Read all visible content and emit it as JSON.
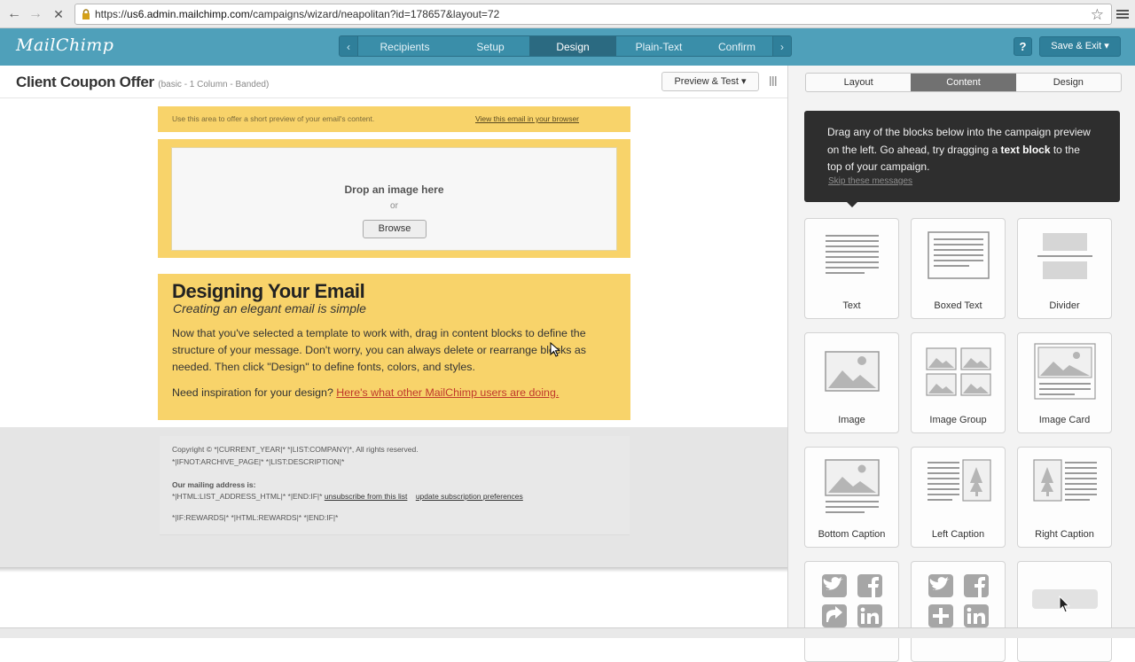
{
  "browser": {
    "back": "←",
    "forward": "→",
    "stop": "✕",
    "url_scheme": "https://",
    "url_host": "us6.admin.mailchimp.com",
    "url_path": "/campaigns/wizard/neapolitan?id=178657&layout=72",
    "star": "☆"
  },
  "header": {
    "logo": "MailChimp",
    "wizard_prev": "‹",
    "wizard_next": "›",
    "steps": [
      {
        "label": "Recipients"
      },
      {
        "label": "Setup"
      },
      {
        "label": "Design"
      },
      {
        "label": "Plain-Text"
      },
      {
        "label": "Confirm"
      }
    ],
    "active_step": "Design",
    "help": "?",
    "save_exit": "Save & Exit ▾"
  },
  "editor": {
    "campaign_title": "Client Coupon Offer",
    "campaign_meta": "(basic - 1 Column - Banded)",
    "preview_button": "Preview & Test ▾",
    "preheader_text": "Use this area to offer a short preview of your email's content.",
    "preheader_link": "View this email in your browser",
    "drop_label": "Drop an image here",
    "drop_or": "or",
    "browse": "Browse",
    "body_title": "Designing Your Email",
    "body_subtitle": "Creating an elegant email is simple",
    "body_text": "Now that you've selected a template to work with, drag in content blocks to define the structure of your message. Don't worry, you can always delete or rearrange blocks as needed. Then click \"Design\" to define fonts, colors, and styles.",
    "inspiration_prefix": "Need inspiration for your design?",
    "inspiration_link": "Here's what other MailChimp users are doing.",
    "footer": {
      "copyright": "Copyright © *|CURRENT_YEAR|* *|LIST:COMPANY|*, All rights reserved.",
      "archive": "*|IFNOT:ARCHIVE_PAGE|* *|LIST:DESCRIPTION|*",
      "mailing_label": "Our mailing address is:",
      "address_tags": "*|HTML:LIST_ADDRESS_HTML|* *|END:IF|*",
      "unsubscribe": "unsubscribe from this list",
      "update_prefs": "update subscription preferences",
      "rewards": "*|IF:REWARDS|* *|HTML:REWARDS|* *|END:IF|*"
    }
  },
  "panel": {
    "tabs": [
      {
        "label": "Layout"
      },
      {
        "label": "Content"
      },
      {
        "label": "Design"
      }
    ],
    "active_tab": "Content",
    "tip_line1": "Drag any of the blocks below into the campaign preview on the left. Go ahead, try dragging a",
    "tip_bold": "text block",
    "tip_line2": "to the top of your campaign.",
    "tip_skip": "Skip these messages",
    "blocks": [
      {
        "label": "Text",
        "icon": "text-block-icon"
      },
      {
        "label": "Boxed Text",
        "icon": "boxed-text-icon"
      },
      {
        "label": "Divider",
        "icon": "divider-icon"
      },
      {
        "label": "Image",
        "icon": "image-icon"
      },
      {
        "label": "Image Group",
        "icon": "image-group-icon"
      },
      {
        "label": "Image Card",
        "icon": "image-card-icon"
      },
      {
        "label": "Bottom Caption",
        "icon": "bottom-caption-icon"
      },
      {
        "label": "Left Caption",
        "icon": "left-caption-icon"
      },
      {
        "label": "Right Caption",
        "icon": "right-caption-icon"
      },
      {
        "label": "",
        "icon": "social-follow-icon"
      },
      {
        "label": "",
        "icon": "social-share-icon"
      },
      {
        "label": "",
        "icon": "button-block-icon"
      }
    ]
  },
  "colors": {
    "header_bg": "#4fa0ba",
    "banner_yellow": "#f8d36a",
    "tip_bg": "#2e2e2e",
    "link_red": "#c0392b"
  }
}
